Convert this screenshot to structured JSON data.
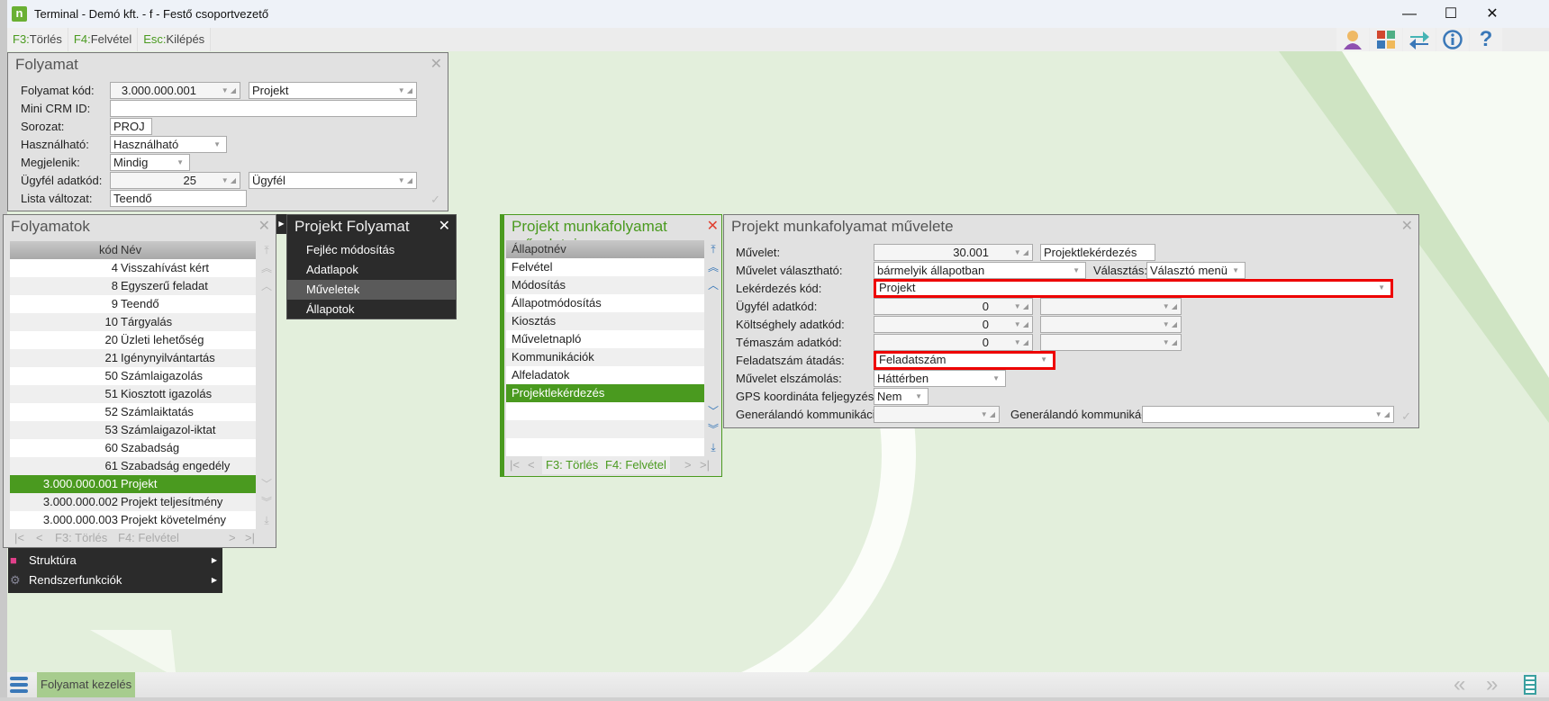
{
  "window": {
    "title": "Terminal - Demó kft. - f - Festő csoportvezető",
    "logo": "n",
    "min": "—",
    "max": "☐",
    "close": "✕"
  },
  "toolbar": {
    "items": [
      {
        "key": "F3:",
        "label": "Törlés"
      },
      {
        "key": "F4:",
        "label": "Felvétel"
      },
      {
        "key": "Esc:",
        "label": "Kilépés"
      }
    ],
    "icons": [
      "user-icon",
      "tiles-icon",
      "swap-icon",
      "info-icon",
      "help-icon"
    ]
  },
  "folyamat": {
    "title": "Folyamat",
    "close": "✕",
    "labels": {
      "kod": "Folyamat kód:",
      "crm": "Mini CRM ID:",
      "sorozat": "Sorozat:",
      "hasznalhato": "Használható:",
      "megjelenik": "Megjelenik:",
      "ugyfel": "Ügyfél adatkód:",
      "lista": "Lista változat:"
    },
    "values": {
      "kod": "3.000.000.001",
      "kod_name": "Projekt",
      "crm": "",
      "sorozat": "PROJ",
      "hasznalhato": "Használható",
      "megjelenik": "Mindig",
      "ugyfel": "25",
      "ugyfel_name": "Ügyfél",
      "lista": "Teendő"
    },
    "ok": "✓"
  },
  "folyamatok": {
    "title": "Folyamatok",
    "close": "✕",
    "col_kod": "kód",
    "col_nev": "Név",
    "rows": [
      [
        "4",
        "Visszahívást kért"
      ],
      [
        "8",
        "Egyszerű feladat"
      ],
      [
        "9",
        "Teendő"
      ],
      [
        "10",
        "Tárgyalás"
      ],
      [
        "20",
        "Üzleti lehetőség"
      ],
      [
        "21",
        "Igénynyilvántartás"
      ],
      [
        "50",
        "Számlaigazolás"
      ],
      [
        "51",
        "Kiosztott igazolás"
      ],
      [
        "52",
        "Számlaiktatás"
      ],
      [
        "53",
        "Számlaigazol-iktat"
      ],
      [
        "60",
        "Szabadság"
      ],
      [
        "61",
        "Szabadság engedély"
      ],
      [
        "3.000.000.001",
        "Projekt"
      ],
      [
        "3.000.000.002",
        "Projekt teljesítmény"
      ],
      [
        "3.000.000.003",
        "Projekt követelmény"
      ]
    ],
    "selected": 12,
    "footer": {
      "del": "F3: Törlés",
      "add": "F4: Felvétel"
    }
  },
  "sidemenu": {
    "items": [
      "Struktúra",
      "Rendszerfunkciók"
    ]
  },
  "projekt_folyamat": {
    "title": "Projekt Folyamat",
    "close": "✕",
    "items": [
      "Fejléc módosítás",
      "Adatlapok",
      "Műveletek",
      "Állapotok"
    ],
    "selected": 2
  },
  "muveletei": {
    "title": "Projekt munkafolyamat műveletei",
    "close": "✕",
    "header": "Állapotnév",
    "rows": [
      "Felvétel",
      "Módosítás",
      "Állapotmódosítás",
      "Kiosztás",
      "Műveletnapló",
      "Kommunikációk",
      "Alfeladatok",
      "Projektlekérdezés",
      "",
      "",
      ""
    ],
    "selected": 7,
    "footer": {
      "del": "F3: Törlés",
      "add": "F4: Felvétel"
    }
  },
  "muvelete": {
    "title": "Projekt munkafolyamat művelete",
    "close": "✕",
    "ok": "✓",
    "labels": {
      "muvelet": "Művelet:",
      "valaszthato": "Művelet választható:",
      "valasztas": "Választás:",
      "lekerdezes": "Lekérdezés kód:",
      "ugyfel": "Ügyfél adatkód:",
      "koltseg": "Költséghely adatkód:",
      "tema": "Témaszám adatkód:",
      "feladatszam": "Feladatszám átadás:",
      "elszamolas": "Művelet elszámolás:",
      "gps": "GPS koordináta feljegyzés:",
      "gen1": "Generálandó kommunikáció:",
      "gen2": "Generálandó kommunikáció:"
    },
    "values": {
      "muvelet": "30.001",
      "muvelet_name": "Projektlekérdezés",
      "valaszthato": "bármelyik állapotban",
      "valasztas": "Választó menü",
      "lekerdezes": "Projekt",
      "ugyfel": "0",
      "koltseg": "0",
      "tema": "0",
      "feladatszam": "Feladatszám",
      "elszamolas": "Háttérben",
      "gps": "Nem",
      "gen1": "",
      "gen2": ""
    },
    "highlight_color": "#e00000"
  },
  "bottombar": {
    "tab": "Folyamat kezelés"
  },
  "colors": {
    "accent": "#4a9a1f",
    "background": "#e3efdc"
  }
}
